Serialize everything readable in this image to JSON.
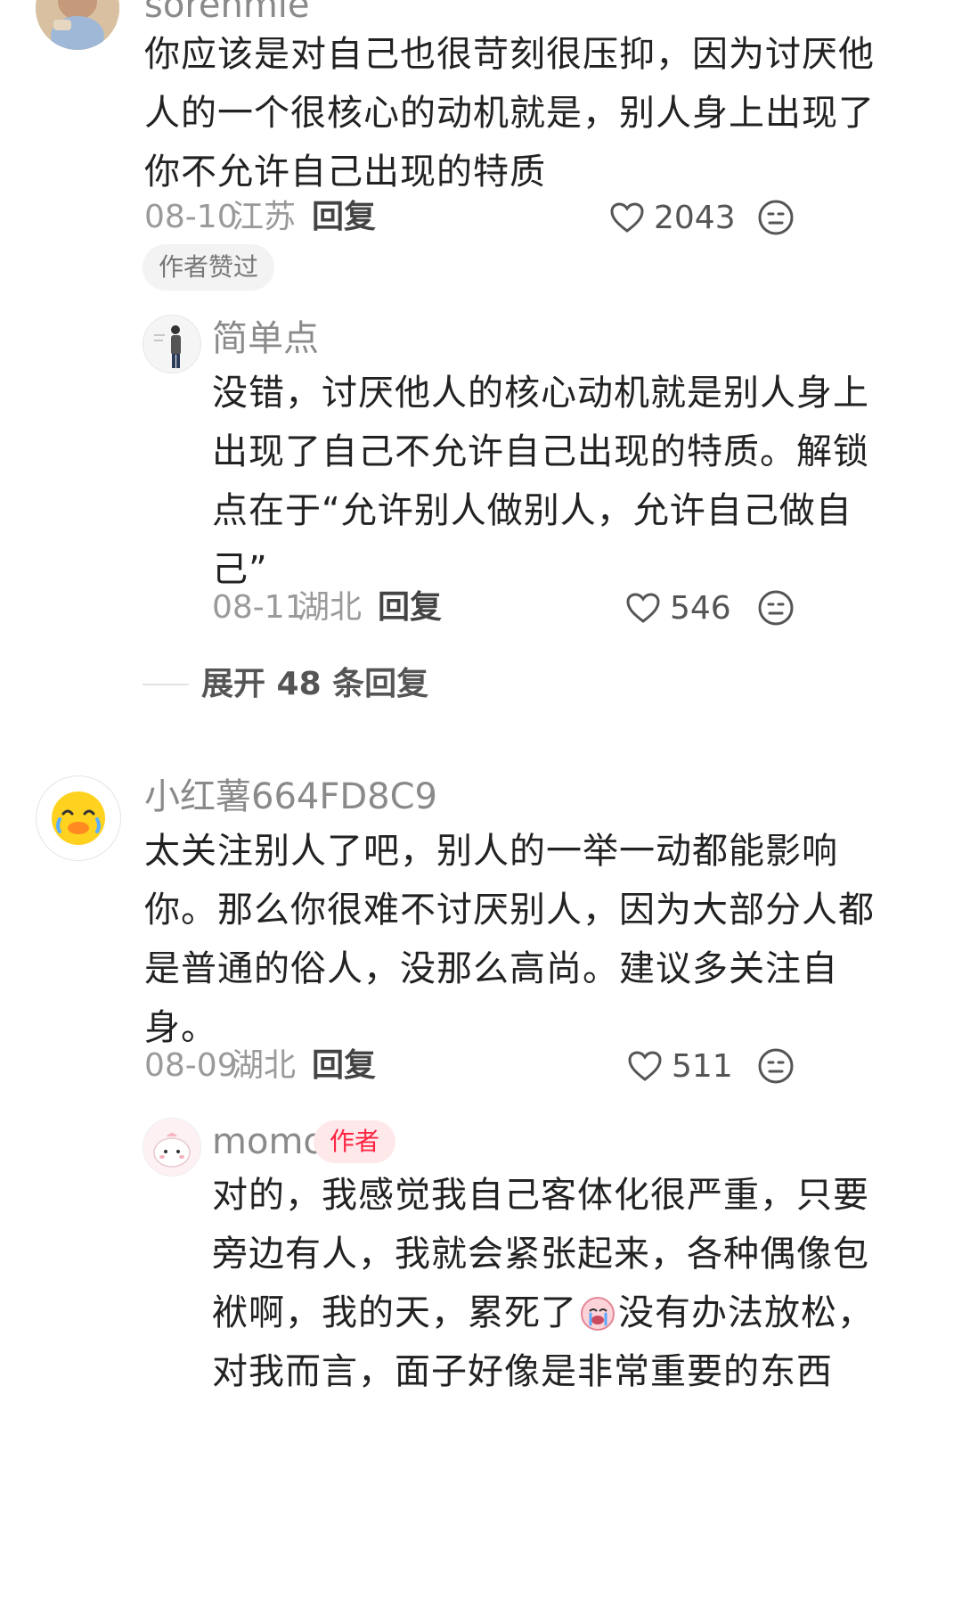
{
  "comments": [
    {
      "username": "sorenmie",
      "lines": [
        "你应该是对自己也很苛刻很压抑，因为讨厌他",
        "人的一个很核心的动机就是，别人身上出现了",
        "你不允许自己出现的特质"
      ],
      "date": "08-10",
      "location": "江苏",
      "reply_label": "回复",
      "likes": "2043",
      "author_liked_chip": "作者赞过",
      "replies": [
        {
          "username": "简单点",
          "lines": [
            "没错，讨厌他人的核心动机就是别人身上",
            "出现了自己不允许自己出现的特质。解锁",
            "点在于“允许别人做别人，允许自己做自",
            "己”"
          ],
          "date": "08-11",
          "location": "湖北",
          "reply_label": "回复",
          "likes": "546"
        }
      ],
      "expand_label": "展开 48 条回复"
    },
    {
      "username": "小红薯664FD8C9",
      "lines": [
        "太关注别人了吧，别人的一举一动都能影响",
        "你。那么你很难不讨厌别人，因为大部分人都",
        "是普通的俗人，没那么高尚。建议多关注自",
        "身。"
      ],
      "date": "08-09",
      "location": "湖北",
      "reply_label": "回复",
      "likes": "511",
      "replies": [
        {
          "username": "momo",
          "author_badge": "作者",
          "lines": [
            "对的，我感觉我自己客体化很严重，只要",
            "旁边有人，我就会紧张起来，各种偶像包",
            "袱啊，我的天，累死了",
            "对我而言，面子好像是非常重要的东西"
          ],
          "line3_tail": "没有办法放松，",
          "emoji_icon": "crying-face-icon"
        }
      ]
    }
  ],
  "colors": {
    "accent": "#ff2442",
    "muted": "#9a9a9a",
    "text": "#222222"
  }
}
